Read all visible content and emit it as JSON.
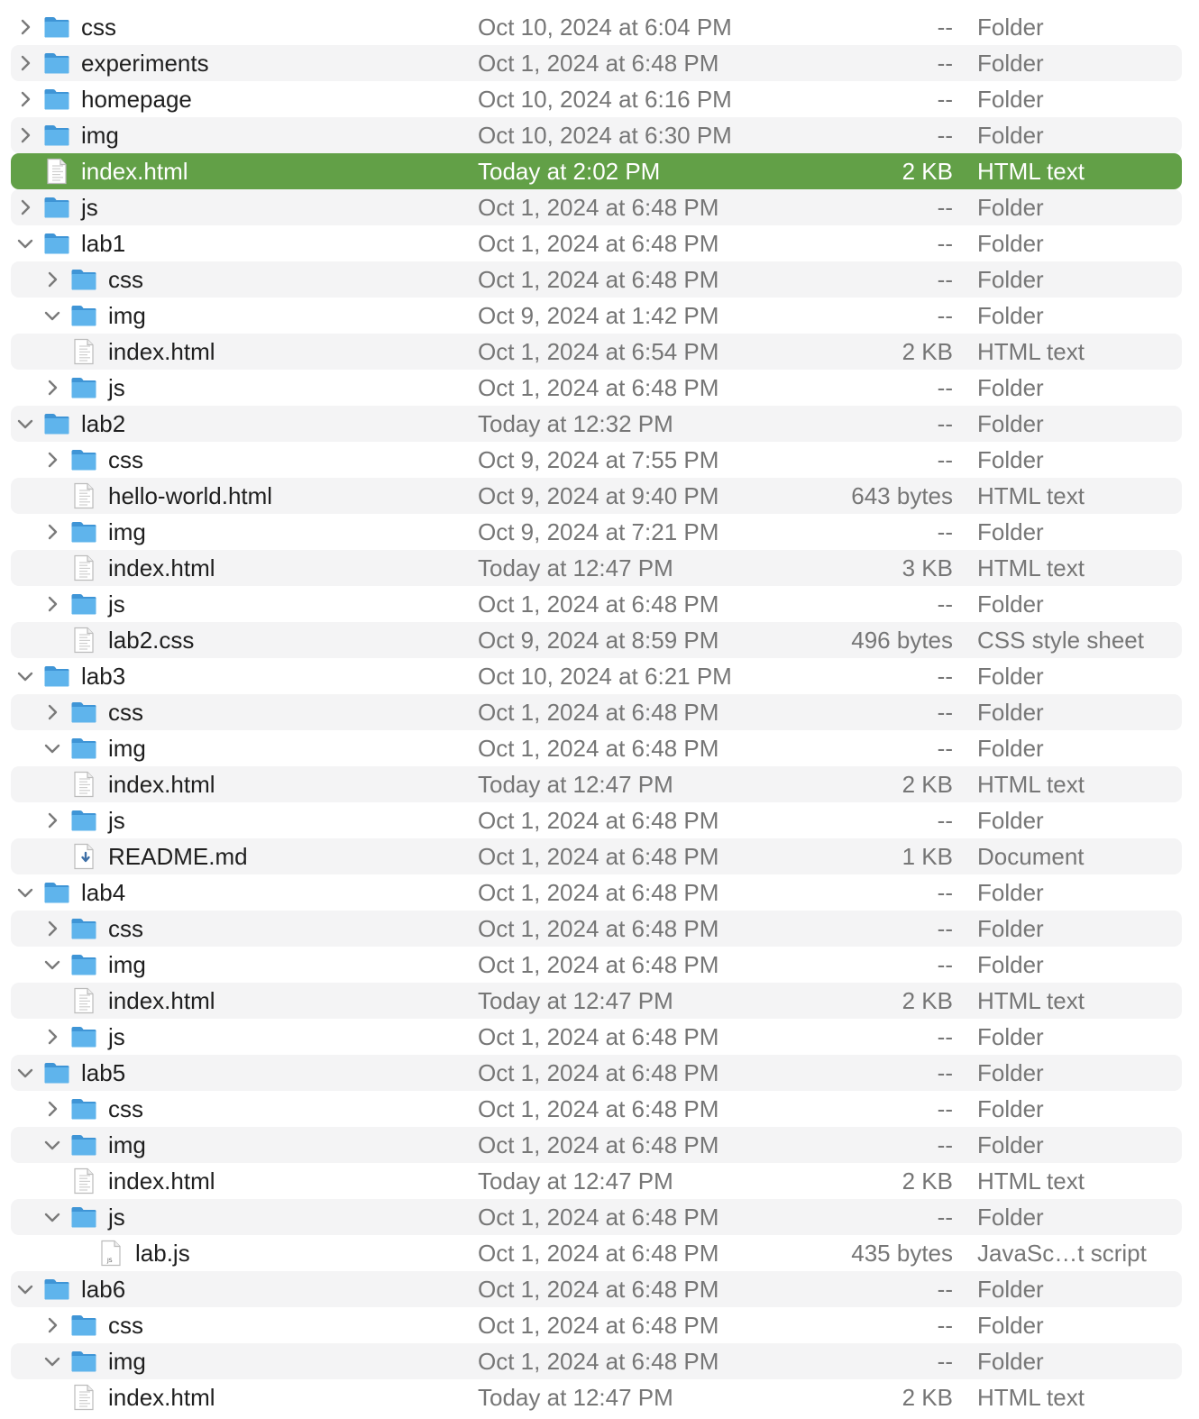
{
  "colors": {
    "selection": "#62a047",
    "alternate_row": "#f4f4f5",
    "folder_blue": "#5fb4ec",
    "secondary_text": "#767676"
  },
  "rows": [
    {
      "depth": 0,
      "disclosure": "collapsed",
      "icon": "folder-icon",
      "name": "css",
      "date": "Oct 10, 2024 at 6:04 PM",
      "size": "--",
      "kind": "Folder"
    },
    {
      "depth": 0,
      "disclosure": "collapsed",
      "icon": "folder-icon",
      "name": "experiments",
      "date": "Oct 1, 2024 at 6:48 PM",
      "size": "--",
      "kind": "Folder"
    },
    {
      "depth": 0,
      "disclosure": "collapsed",
      "icon": "folder-icon",
      "name": "homepage",
      "date": "Oct 10, 2024 at 6:16 PM",
      "size": "--",
      "kind": "Folder"
    },
    {
      "depth": 0,
      "disclosure": "collapsed",
      "icon": "folder-icon",
      "name": "img",
      "date": "Oct 10, 2024 at 6:30 PM",
      "size": "--",
      "kind": "Folder"
    },
    {
      "depth": 0,
      "disclosure": "none",
      "icon": "html-file-icon",
      "name": "index.html",
      "date": "Today at 2:02 PM",
      "size": "2 KB",
      "kind": "HTML text",
      "selected": true
    },
    {
      "depth": 0,
      "disclosure": "collapsed",
      "icon": "folder-icon",
      "name": "js",
      "date": "Oct 1, 2024 at 6:48 PM",
      "size": "--",
      "kind": "Folder"
    },
    {
      "depth": 0,
      "disclosure": "expanded",
      "icon": "folder-icon",
      "name": "lab1",
      "date": "Oct 1, 2024 at 6:48 PM",
      "size": "--",
      "kind": "Folder"
    },
    {
      "depth": 1,
      "disclosure": "collapsed",
      "icon": "folder-icon",
      "name": "css",
      "date": "Oct 1, 2024 at 6:48 PM",
      "size": "--",
      "kind": "Folder"
    },
    {
      "depth": 1,
      "disclosure": "expanded",
      "icon": "folder-icon",
      "name": "img",
      "date": "Oct 9, 2024 at 1:42 PM",
      "size": "--",
      "kind": "Folder"
    },
    {
      "depth": 1,
      "disclosure": "none",
      "icon": "html-file-icon",
      "name": "index.html",
      "date": "Oct 1, 2024 at 6:54 PM",
      "size": "2 KB",
      "kind": "HTML text"
    },
    {
      "depth": 1,
      "disclosure": "collapsed",
      "icon": "folder-icon",
      "name": "js",
      "date": "Oct 1, 2024 at 6:48 PM",
      "size": "--",
      "kind": "Folder"
    },
    {
      "depth": 0,
      "disclosure": "expanded",
      "icon": "folder-icon",
      "name": "lab2",
      "date": "Today at 12:32 PM",
      "size": "--",
      "kind": "Folder"
    },
    {
      "depth": 1,
      "disclosure": "collapsed",
      "icon": "folder-icon",
      "name": "css",
      "date": "Oct 9, 2024 at 7:55 PM",
      "size": "--",
      "kind": "Folder"
    },
    {
      "depth": 1,
      "disclosure": "none",
      "icon": "html-file-icon",
      "name": "hello-world.html",
      "date": "Oct 9, 2024 at 9:40 PM",
      "size": "643 bytes",
      "kind": "HTML text"
    },
    {
      "depth": 1,
      "disclosure": "collapsed",
      "icon": "folder-icon",
      "name": "img",
      "date": "Oct 9, 2024 at 7:21 PM",
      "size": "--",
      "kind": "Folder"
    },
    {
      "depth": 1,
      "disclosure": "none",
      "icon": "html-file-icon",
      "name": "index.html",
      "date": "Today at 12:47 PM",
      "size": "3 KB",
      "kind": "HTML text"
    },
    {
      "depth": 1,
      "disclosure": "collapsed",
      "icon": "folder-icon",
      "name": "js",
      "date": "Oct 1, 2024 at 6:48 PM",
      "size": "--",
      "kind": "Folder"
    },
    {
      "depth": 1,
      "disclosure": "none",
      "icon": "css-file-icon",
      "name": "lab2.css",
      "date": "Oct 9, 2024 at 8:59 PM",
      "size": "496 bytes",
      "kind": "CSS style sheet"
    },
    {
      "depth": 0,
      "disclosure": "expanded",
      "icon": "folder-icon",
      "name": "lab3",
      "date": "Oct 10, 2024 at 6:21 PM",
      "size": "--",
      "kind": "Folder"
    },
    {
      "depth": 1,
      "disclosure": "collapsed",
      "icon": "folder-icon",
      "name": "css",
      "date": "Oct 1, 2024 at 6:48 PM",
      "size": "--",
      "kind": "Folder"
    },
    {
      "depth": 1,
      "disclosure": "expanded",
      "icon": "folder-icon",
      "name": "img",
      "date": "Oct 1, 2024 at 6:48 PM",
      "size": "--",
      "kind": "Folder"
    },
    {
      "depth": 1,
      "disclosure": "none",
      "icon": "html-file-icon",
      "name": "index.html",
      "date": "Today at 12:47 PM",
      "size": "2 KB",
      "kind": "HTML text"
    },
    {
      "depth": 1,
      "disclosure": "collapsed",
      "icon": "folder-icon",
      "name": "js",
      "date": "Oct 1, 2024 at 6:48 PM",
      "size": "--",
      "kind": "Folder"
    },
    {
      "depth": 1,
      "disclosure": "none",
      "icon": "markdown-file-icon",
      "name": "README.md",
      "date": "Oct 1, 2024 at 6:48 PM",
      "size": "1 KB",
      "kind": "Document"
    },
    {
      "depth": 0,
      "disclosure": "expanded",
      "icon": "folder-icon",
      "name": "lab4",
      "date": "Oct 1, 2024 at 6:48 PM",
      "size": "--",
      "kind": "Folder"
    },
    {
      "depth": 1,
      "disclosure": "collapsed",
      "icon": "folder-icon",
      "name": "css",
      "date": "Oct 1, 2024 at 6:48 PM",
      "size": "--",
      "kind": "Folder"
    },
    {
      "depth": 1,
      "disclosure": "expanded",
      "icon": "folder-icon",
      "name": "img",
      "date": "Oct 1, 2024 at 6:48 PM",
      "size": "--",
      "kind": "Folder"
    },
    {
      "depth": 1,
      "disclosure": "none",
      "icon": "html-file-icon",
      "name": "index.html",
      "date": "Today at 12:47 PM",
      "size": "2 KB",
      "kind": "HTML text"
    },
    {
      "depth": 1,
      "disclosure": "collapsed",
      "icon": "folder-icon",
      "name": "js",
      "date": "Oct 1, 2024 at 6:48 PM",
      "size": "--",
      "kind": "Folder"
    },
    {
      "depth": 0,
      "disclosure": "expanded",
      "icon": "folder-icon",
      "name": "lab5",
      "date": "Oct 1, 2024 at 6:48 PM",
      "size": "--",
      "kind": "Folder"
    },
    {
      "depth": 1,
      "disclosure": "collapsed",
      "icon": "folder-icon",
      "name": "css",
      "date": "Oct 1, 2024 at 6:48 PM",
      "size": "--",
      "kind": "Folder"
    },
    {
      "depth": 1,
      "disclosure": "expanded",
      "icon": "folder-icon",
      "name": "img",
      "date": "Oct 1, 2024 at 6:48 PM",
      "size": "--",
      "kind": "Folder"
    },
    {
      "depth": 1,
      "disclosure": "none",
      "icon": "html-file-icon",
      "name": "index.html",
      "date": "Today at 12:47 PM",
      "size": "2 KB",
      "kind": "HTML text"
    },
    {
      "depth": 1,
      "disclosure": "expanded",
      "icon": "folder-icon",
      "name": "js",
      "date": "Oct 1, 2024 at 6:48 PM",
      "size": "--",
      "kind": "Folder"
    },
    {
      "depth": 2,
      "disclosure": "none",
      "icon": "js-file-icon",
      "name": "lab.js",
      "date": "Oct 1, 2024 at 6:48 PM",
      "size": "435 bytes",
      "kind": "JavaSc…t script"
    },
    {
      "depth": 0,
      "disclosure": "expanded",
      "icon": "folder-icon",
      "name": "lab6",
      "date": "Oct 1, 2024 at 6:48 PM",
      "size": "--",
      "kind": "Folder"
    },
    {
      "depth": 1,
      "disclosure": "collapsed",
      "icon": "folder-icon",
      "name": "css",
      "date": "Oct 1, 2024 at 6:48 PM",
      "size": "--",
      "kind": "Folder"
    },
    {
      "depth": 1,
      "disclosure": "expanded",
      "icon": "folder-icon",
      "name": "img",
      "date": "Oct 1, 2024 at 6:48 PM",
      "size": "--",
      "kind": "Folder"
    },
    {
      "depth": 1,
      "disclosure": "none",
      "icon": "html-file-icon",
      "name": "index.html",
      "date": "Today at 12:47 PM",
      "size": "2 KB",
      "kind": "HTML text"
    }
  ]
}
